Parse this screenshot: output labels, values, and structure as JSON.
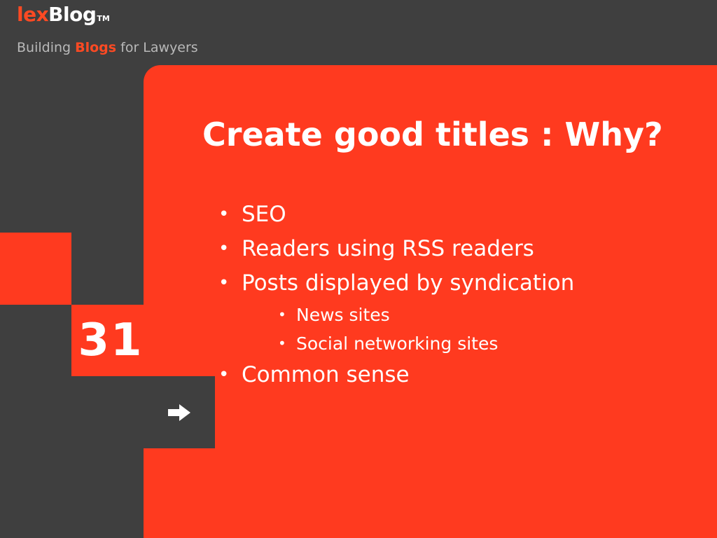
{
  "header": {
    "logo": {
      "part1": "lex",
      "part2": "Blog",
      "trademark": "TM"
    },
    "tagline": {
      "prefix": "Building ",
      "accent": "Blogs",
      "suffix": " for Lawyers"
    }
  },
  "slide": {
    "title": "Create good titles : Why?",
    "page_number": "31",
    "next_icon": "arrow-right-icon",
    "bullets": [
      {
        "text": "SEO"
      },
      {
        "text": "Readers using RSS readers"
      },
      {
        "text": "Posts displayed by syndication",
        "subitems": [
          {
            "text": "News sites"
          },
          {
            "text": "Social networking sites"
          }
        ]
      },
      {
        "text": "Common sense"
      }
    ]
  },
  "colors": {
    "accent": "#ff3a1f",
    "dark_background": "#3f3f3f",
    "light_text": "#ffffff",
    "muted_text": "#b9b9b9"
  }
}
